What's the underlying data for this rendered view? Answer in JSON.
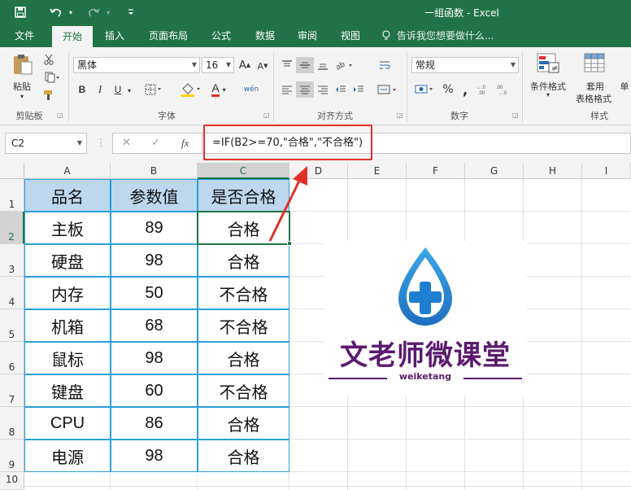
{
  "window": {
    "title": "一组函数 - Excel"
  },
  "quick_access": {
    "save": "save-icon",
    "undo": "undo-icon",
    "redo": "redo-icon",
    "customize": "customize-icon"
  },
  "tabs": [
    "文件",
    "开始",
    "插入",
    "页面布局",
    "公式",
    "数据",
    "审阅",
    "视图"
  ],
  "tell_me": "告诉我您想要做什么...",
  "ribbon": {
    "clipboard": {
      "paste": "粘贴",
      "label": "剪贴板"
    },
    "font": {
      "name": "黑体",
      "size": "16",
      "bold": "B",
      "italic": "I",
      "underline": "U",
      "color_letter": "A",
      "wen": "wén",
      "label": "字体"
    },
    "alignment": {
      "label": "对齐方式"
    },
    "number": {
      "format": "常规",
      "percent": "%",
      "comma": ",",
      "label": "数字"
    },
    "styles": {
      "conditional": "条件格式",
      "table_format_1": "套用",
      "table_format_2": "表格格式",
      "cell_style": "单",
      "label": "样式"
    }
  },
  "formula_bar": {
    "name_box": "C2",
    "fx": "fx",
    "formula": "=IF(B2>=70,\"合格\",\"不合格\")"
  },
  "columns": [
    "A",
    "B",
    "C",
    "D",
    "E",
    "F",
    "G",
    "H",
    "I"
  ],
  "rows": [
    "1",
    "2",
    "3",
    "4",
    "5",
    "6",
    "7",
    "8",
    "9",
    "10"
  ],
  "table": {
    "headers": [
      "品名",
      "参数值",
      "是否合格"
    ],
    "rows": [
      [
        "主板",
        "89",
        "合格"
      ],
      [
        "硬盘",
        "98",
        "合格"
      ],
      [
        "内存",
        "50",
        "不合格"
      ],
      [
        "机箱",
        "68",
        "不合格"
      ],
      [
        "鼠标",
        "98",
        "合格"
      ],
      [
        "键盘",
        "60",
        "不合格"
      ],
      [
        "CPU",
        "86",
        "合格"
      ],
      [
        "电源",
        "98",
        "合格"
      ]
    ]
  },
  "logo": {
    "title": "文老师微课堂",
    "subtitle": "weiketang"
  },
  "colors": {
    "excel_green": "#217346",
    "header_fill": "#bdd7ee",
    "table_border": "#2a9fd8",
    "highlight_red": "#e0302a",
    "logo_purple": "#5b1a6e",
    "logo_blue": "#1e88d6"
  }
}
